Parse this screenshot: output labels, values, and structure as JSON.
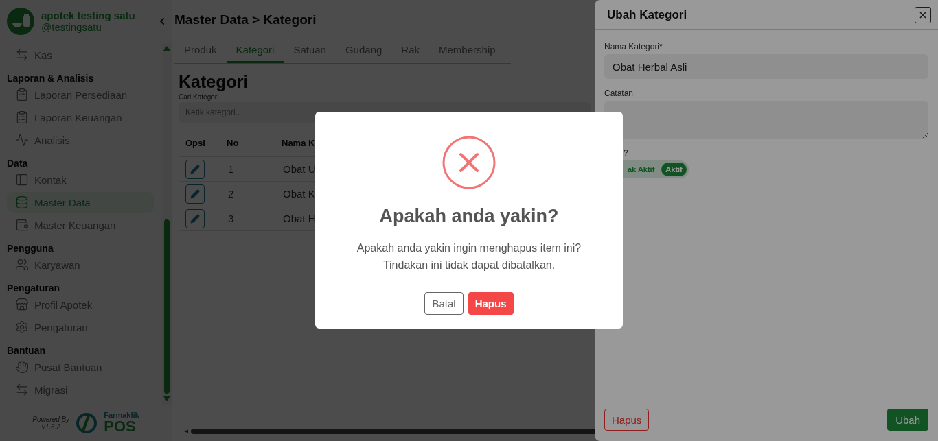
{
  "sidebar": {
    "brand": {
      "name": "apotek testing satu",
      "handle": "@testingsatu"
    },
    "sections": [
      {
        "items": [
          {
            "label": "Kas",
            "selected": false
          }
        ]
      },
      {
        "title": "Laporan & Analisis",
        "items": [
          {
            "label": "Laporan Persediaan",
            "selected": false
          },
          {
            "label": "Laporan Keuangan",
            "selected": false
          },
          {
            "label": "Analisis",
            "selected": false
          }
        ]
      },
      {
        "title": "Data",
        "items": [
          {
            "label": "Kontak",
            "selected": false
          },
          {
            "label": "Master Data",
            "selected": true
          },
          {
            "label": "Master Keuangan",
            "selected": false
          }
        ]
      },
      {
        "title": "Pengguna",
        "items": [
          {
            "label": "Karyawan",
            "selected": false
          }
        ]
      },
      {
        "title": "Pengaturan",
        "items": [
          {
            "label": "Profil Apotek",
            "selected": false
          },
          {
            "label": "Pengaturan",
            "selected": false
          }
        ]
      },
      {
        "title": "Bantuan",
        "items": [
          {
            "label": "Pusat Bantuan",
            "selected": false
          },
          {
            "label": "Migrasi",
            "selected": false
          }
        ]
      }
    ],
    "footer": {
      "powered_by": "Powered By",
      "version": "v1.6.2",
      "logo_top": "Farmaklik",
      "logo_bottom": "POS"
    }
  },
  "page": {
    "breadcrumb": "Master Data > Kategori",
    "tabs": [
      {
        "label": "Produk",
        "selected": false
      },
      {
        "label": "Kategori",
        "selected": true
      },
      {
        "label": "Satuan",
        "selected": false
      },
      {
        "label": "Gudang",
        "selected": false
      },
      {
        "label": "Rak",
        "selected": false
      },
      {
        "label": "Membership",
        "selected": false
      }
    ],
    "heading": "Kategori",
    "search": {
      "label": "Cari Kategori",
      "placeholder": "Ketik kategori.."
    },
    "table": {
      "columns": [
        "Opsi",
        "No",
        "Nama K"
      ],
      "rows": [
        {
          "no": "1",
          "name": "Obat U"
        },
        {
          "no": "2",
          "name": "Obat K"
        },
        {
          "no": "3",
          "name": "Obat H"
        }
      ]
    }
  },
  "drawer": {
    "title": "Ubah Kategori",
    "name_label": "Nama Kategori*",
    "name_value": "Obat Herbal Asli",
    "note_label": "Catatan",
    "status_label": "?",
    "status_options": [
      {
        "label": "ak Aktif",
        "selected": false
      },
      {
        "label": "Aktif",
        "selected": true
      }
    ],
    "delete_button": "Hapus",
    "save_button": "Ubah"
  },
  "dialog": {
    "title": "Apakah anda yakin?",
    "message": [
      "Apakah anda yakin ingin menghapus item ini?",
      "Tindakan ini tidak dapat dibatalkan."
    ],
    "buttons": [
      {
        "label": "Batal",
        "kind": "secondary"
      },
      {
        "label": "Hapus",
        "kind": "danger"
      }
    ]
  }
}
